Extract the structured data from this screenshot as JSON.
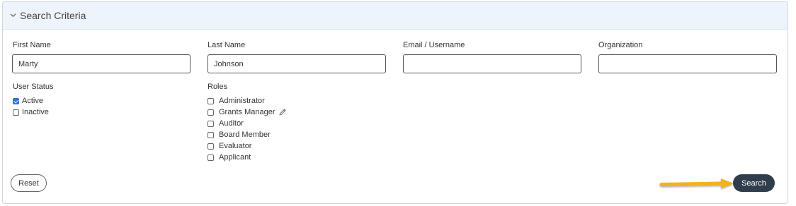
{
  "panel": {
    "title": "Search Criteria",
    "expanded_icon": "chevron-down-icon"
  },
  "fields": {
    "first_name": {
      "label": "First Name",
      "value": "Marty"
    },
    "last_name": {
      "label": "Last Name",
      "value": "Johnson"
    },
    "email": {
      "label": "Email / Username",
      "value": ""
    },
    "organization": {
      "label": "Organization",
      "value": ""
    }
  },
  "user_status": {
    "label": "User Status",
    "options": [
      {
        "label": "Active",
        "checked": true
      },
      {
        "label": "Inactive",
        "checked": false
      }
    ]
  },
  "roles": {
    "label": "Roles",
    "options": [
      {
        "label": "Administrator",
        "checked": false
      },
      {
        "label": "Grants Manager",
        "checked": false
      },
      {
        "label": "Auditor",
        "checked": false
      },
      {
        "label": "Board Member",
        "checked": false
      },
      {
        "label": "Evaluator",
        "checked": false
      },
      {
        "label": "Applicant",
        "checked": false
      }
    ]
  },
  "buttons": {
    "reset": "Reset",
    "search": "Search"
  },
  "colors": {
    "header_bg": "#eef4fb",
    "search_button": "#2f3d4c",
    "checkbox_checked": "#2f6fd6",
    "arrow": "#f2b21b"
  }
}
